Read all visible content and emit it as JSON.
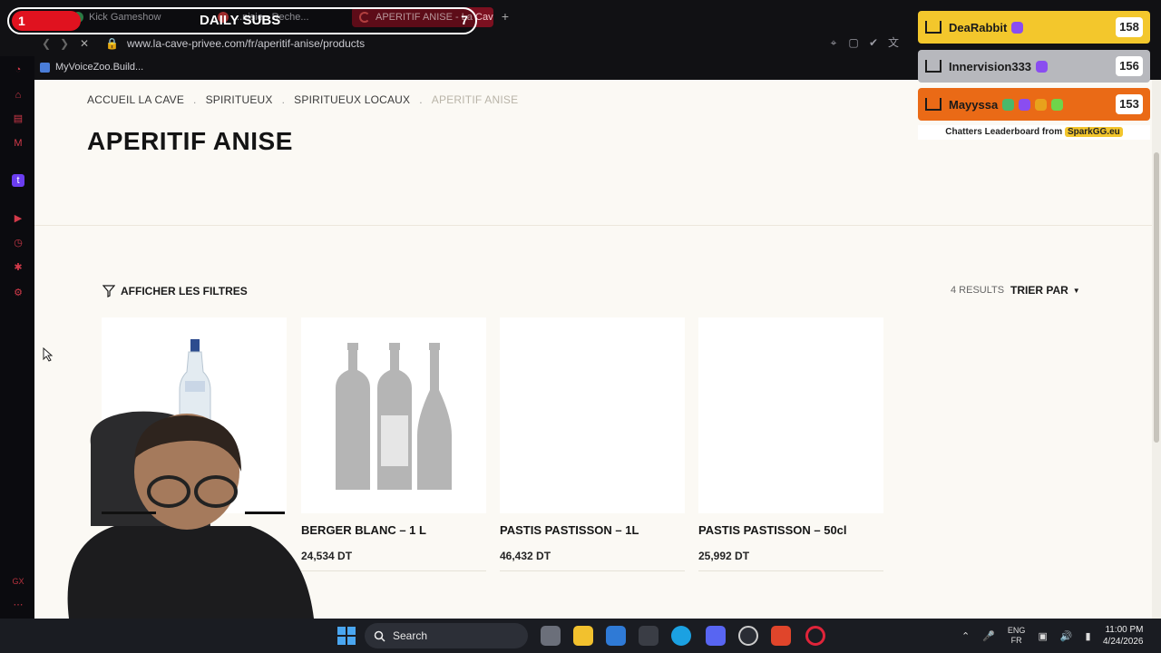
{
  "browser": {
    "tabs": [
      {
        "label": "Kick Gameshow",
        "active": false
      },
      {
        "label": "...nisie - Reche...",
        "active": false
      },
      {
        "label": "APERITIF ANISE - La Cave",
        "active": true
      }
    ],
    "url": "www.la-cave-privee.com/fr/aperitif-anise/products",
    "bookmark": "MyVoiceZoo.Build..."
  },
  "subs_overlay": {
    "count": "1",
    "title": "DAILY SUBS",
    "goal": "7"
  },
  "page": {
    "breadcrumb": [
      "ACCUEIL LA CAVE",
      "SPIRITUEUX",
      "SPIRITUEUX LOCAUX",
      "APERITIF ANISE"
    ],
    "breadcrumb_sep": ".",
    "title": "APERITIF ANISE",
    "filters_label": "AFFICHER LES FILTRES",
    "results_label": "4 RESULTS",
    "sort_label": "TRIER PAR",
    "products": [
      {
        "name": "",
        "price": ""
      },
      {
        "name": "BERGER BLANC – 1 L",
        "price": "24,534 DT"
      },
      {
        "name": "PASTIS PASTISSON – 1L",
        "price": "46,432 DT"
      },
      {
        "name": "PASTIS PASTISSON – 50cl",
        "price": "25,992 DT"
      }
    ]
  },
  "leaderboard": {
    "entries": [
      {
        "name": "DeaRabbit",
        "score": "158",
        "color": "#f3c72c"
      },
      {
        "name": "Innervision333",
        "score": "156",
        "color": "#b7b8bd"
      },
      {
        "name": "Mayyssa",
        "score": "153",
        "color": "#ea6a16"
      }
    ],
    "footer_prefix": "Chatters Leaderboard from",
    "footer_brand": "SparkGG.eu"
  },
  "taskbar": {
    "search_label": "Search",
    "lang_top": "ENG",
    "lang_bottom": "FR",
    "time": "11:00 PM",
    "date": "4/24/2026"
  }
}
